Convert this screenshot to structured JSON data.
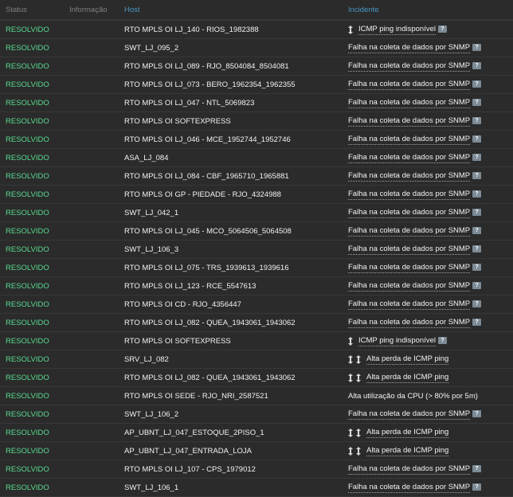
{
  "header": {
    "status": "Status",
    "info": "Informação",
    "host": "Host",
    "incident": "Incidente"
  },
  "rows": [
    {
      "status": "RESOLVIDO",
      "host": "RTO MPLS OI LJ_140 - RIOS_1982388",
      "incident": "ICMP ping indisponível",
      "arrows": 1,
      "hint": true
    },
    {
      "status": "RESOLVIDO",
      "host": "SWT_LJ_095_2",
      "incident": "Falha na coleta de dados por SNMP",
      "arrows": 0,
      "hint": true
    },
    {
      "status": "RESOLVIDO",
      "host": "RTO MPLS OI LJ_089 - RJO_8504084_8504081",
      "incident": "Falha na coleta de dados por SNMP",
      "arrows": 0,
      "hint": true
    },
    {
      "status": "RESOLVIDO",
      "host": "RTO MPLS OI LJ_073 - BERO_1962354_1962355",
      "incident": "Falha na coleta de dados por SNMP",
      "arrows": 0,
      "hint": true
    },
    {
      "status": "RESOLVIDO",
      "host": "RTO MPLS OI LJ_047 - NTL_5069823",
      "incident": "Falha na coleta de dados por SNMP",
      "arrows": 0,
      "hint": true
    },
    {
      "status": "RESOLVIDO",
      "host": "RTO MPLS OI SOFTEXPRESS",
      "incident": "Falha na coleta de dados por SNMP",
      "arrows": 0,
      "hint": true
    },
    {
      "status": "RESOLVIDO",
      "host": "RTO MPLS OI LJ_046 - MCE_1952744_1952746",
      "incident": "Falha na coleta de dados por SNMP",
      "arrows": 0,
      "hint": true
    },
    {
      "status": "RESOLVIDO",
      "host": "ASA_LJ_084",
      "incident": "Falha na coleta de dados por SNMP",
      "arrows": 0,
      "hint": true
    },
    {
      "status": "RESOLVIDO",
      "host": "RTO MPLS OI LJ_084 - CBF_1965710_1965881",
      "incident": "Falha na coleta de dados por SNMP",
      "arrows": 0,
      "hint": true
    },
    {
      "status": "RESOLVIDO",
      "host": "RTO MPLS OI GP - PIEDADE - RJO_4324988",
      "incident": "Falha na coleta de dados por SNMP",
      "arrows": 0,
      "hint": true
    },
    {
      "status": "RESOLVIDO",
      "host": "SWT_LJ_042_1",
      "incident": "Falha na coleta de dados por SNMP",
      "arrows": 0,
      "hint": true
    },
    {
      "status": "RESOLVIDO",
      "host": "RTO MPLS OI LJ_045 - MCO_5064506_5064508",
      "incident": "Falha na coleta de dados por SNMP",
      "arrows": 0,
      "hint": true
    },
    {
      "status": "RESOLVIDO",
      "host": "SWT_LJ_106_3",
      "incident": "Falha na coleta de dados por SNMP",
      "arrows": 0,
      "hint": true
    },
    {
      "status": "RESOLVIDO",
      "host": "RTO MPLS OI LJ_075 - TRS_1939613_1939616",
      "incident": "Falha na coleta de dados por SNMP",
      "arrows": 0,
      "hint": true
    },
    {
      "status": "RESOLVIDO",
      "host": "RTO MPLS OI LJ_123 - RCE_5547613",
      "incident": "Falha na coleta de dados por SNMP",
      "arrows": 0,
      "hint": true
    },
    {
      "status": "RESOLVIDO",
      "host": "RTO MPLS OI CD - RJO_4356447",
      "incident": "Falha na coleta de dados por SNMP",
      "arrows": 0,
      "hint": true
    },
    {
      "status": "RESOLVIDO",
      "host": "RTO MPLS OI LJ_082 - QUEA_1943061_1943062",
      "incident": "Falha na coleta de dados por SNMP",
      "arrows": 0,
      "hint": true
    },
    {
      "status": "RESOLVIDO",
      "host": "RTO MPLS OI SOFTEXPRESS",
      "incident": "ICMP ping indisponível",
      "arrows": 1,
      "hint": true
    },
    {
      "status": "RESOLVIDO",
      "host": "SRV_LJ_082",
      "incident": "Alta perda de ICMP ping",
      "arrows": 2,
      "hint": false
    },
    {
      "status": "RESOLVIDO",
      "host": "RTO MPLS OI LJ_082 - QUEA_1943061_1943062",
      "incident": "Alta perda de ICMP ping",
      "arrows": 2,
      "hint": false
    },
    {
      "status": "RESOLVIDO",
      "host": "RTO MPLS OI SEDE - RJO_NRI_2587521",
      "incident": "Alta utilização da CPU (> 80% por 5m)",
      "arrows": 0,
      "hint": false,
      "plain": true
    },
    {
      "status": "RESOLVIDO",
      "host": "SWT_LJ_106_2",
      "incident": "Falha na coleta de dados por SNMP",
      "arrows": 0,
      "hint": true
    },
    {
      "status": "RESOLVIDO",
      "host": "AP_UBNT_LJ_047_ESTOQUE_2PISO_1",
      "incident": "Alta perda de ICMP ping",
      "arrows": 2,
      "hint": false
    },
    {
      "status": "RESOLVIDO",
      "host": "AP_UBNT_LJ_047_ENTRADA_LOJA",
      "incident": "Alta perda de ICMP ping",
      "arrows": 2,
      "hint": false
    },
    {
      "status": "RESOLVIDO",
      "host": "RTO MPLS OI LJ_107 - CPS_1979012",
      "incident": "Falha na coleta de dados por SNMP",
      "arrows": 0,
      "hint": true
    },
    {
      "status": "RESOLVIDO",
      "host": "SWT_LJ_106_1",
      "incident": "Falha na coleta de dados por SNMP",
      "arrows": 0,
      "hint": true
    }
  ],
  "colors": {
    "status_ok": "#59db8f",
    "header_link": "#4796c4",
    "hint_icon": "#7c8b95"
  },
  "icons": {
    "hint": "?",
    "arrow": "up-down-arrow-icon"
  }
}
